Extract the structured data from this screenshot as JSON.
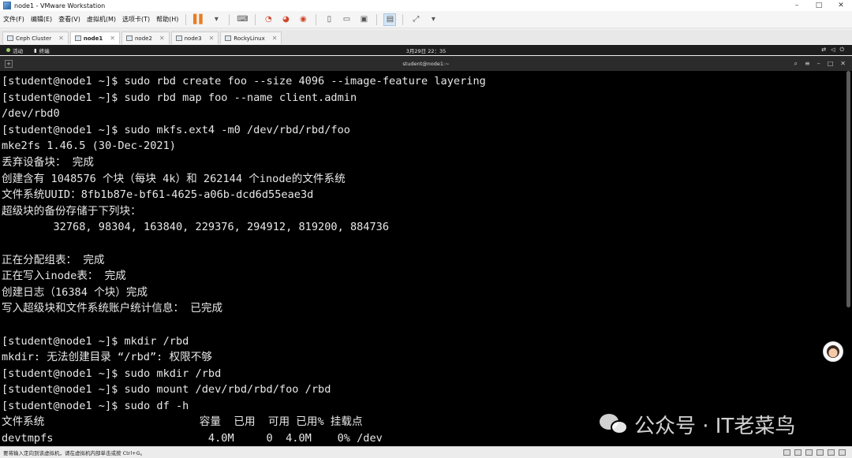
{
  "window": {
    "title": "node1 - VMware Workstation",
    "controls": [
      "–",
      "□",
      "✕"
    ]
  },
  "menu": {
    "items": [
      "文件(F)",
      "编辑(E)",
      "查看(V)",
      "虚拟机(M)",
      "选项卡(T)",
      "帮助(H)"
    ]
  },
  "tabs": [
    {
      "label": "Ceph Cluster",
      "active": false
    },
    {
      "label": "node1",
      "active": true
    },
    {
      "label": "node2",
      "active": false
    },
    {
      "label": "node3",
      "active": false
    },
    {
      "label": "RockyLinux",
      "active": false
    }
  ],
  "guest_topbar": {
    "activities": "活动",
    "terminal": "终端",
    "clock": "3月29日  22：35"
  },
  "terminal_header": {
    "title": "student@node1:~"
  },
  "terminal": {
    "lines": [
      "[student@node1 ~]$ sudo rbd create foo --size 4096 --image-feature layering",
      "[student@node1 ~]$ sudo rbd map foo --name client.admin",
      "/dev/rbd0",
      "[student@node1 ~]$ sudo mkfs.ext4 -m0 /dev/rbd/rbd/foo",
      "mke2fs 1.46.5 (30-Dec-2021)",
      "丢弃设备块： 完成",
      "创建含有 1048576 个块（每块 4k）和 262144 个inode的文件系统",
      "文件系统UUID：8fb1b87e-bf61-4625-a06b-dcd6d55eae3d",
      "超级块的备份存储于下列块：",
      "        32768, 98304, 163840, 229376, 294912, 819200, 884736",
      "",
      "正在分配组表： 完成",
      "正在写入inode表： 完成",
      "创建日志（16384 个块）完成",
      "写入超级块和文件系统账户统计信息： 已完成",
      "",
      "[student@node1 ~]$ mkdir /rbd",
      "mkdir: 无法创建目录 “/rbd”: 权限不够",
      "[student@node1 ~]$ sudo mkdir /rbd",
      "[student@node1 ~]$ sudo mount /dev/rbd/rbd/foo /rbd",
      "[student@node1 ~]$ sudo df -h",
      "文件系统                        容量  已用  可用 已用% 挂载点",
      "devtmpfs                        4.0M     0  4.0M    0% /dev"
    ]
  },
  "watermark": {
    "text": "公众号 · IT老菜鸟"
  },
  "statusbar": {
    "message": "要将输入定向到该虚拟机，请在虚拟机内部单击或按 Ctrl+G。"
  }
}
